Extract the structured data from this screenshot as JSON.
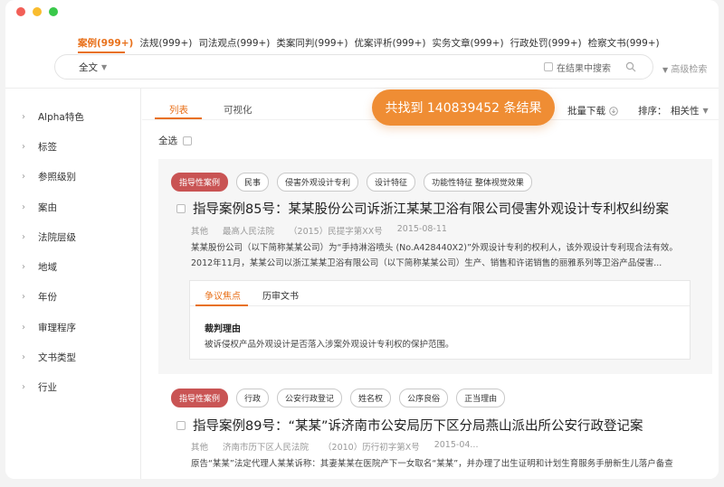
{
  "colors": {
    "accent": "#e8701a",
    "tag_primary": "#c95454",
    "pill": "#ef8d34"
  },
  "top_tabs": [
    {
      "label": "案例(999+)"
    },
    {
      "label": "法规(999+)"
    },
    {
      "label": "司法观点(999+)"
    },
    {
      "label": "类案同判(999+)"
    },
    {
      "label": "优案评析(999+)"
    },
    {
      "label": "实务文章(999+)"
    },
    {
      "label": "行政处罚(999+)"
    },
    {
      "label": "检察文书(999+)"
    }
  ],
  "search": {
    "scope": "全文",
    "value": "",
    "in_result_label": "在结果中搜索",
    "advanced_label": "高级检索"
  },
  "sidebar": {
    "items": [
      {
        "label": "Alpha特色"
      },
      {
        "label": "标签"
      },
      {
        "label": "参照级别"
      },
      {
        "label": "案由"
      },
      {
        "label": "法院层级"
      },
      {
        "label": "地域"
      },
      {
        "label": "年份"
      },
      {
        "label": "审理程序"
      },
      {
        "label": "文书类型"
      },
      {
        "label": "行业"
      }
    ]
  },
  "main": {
    "view_tabs": [
      {
        "label": "列表"
      },
      {
        "label": "可视化"
      }
    ],
    "batch_download": "批量下载",
    "sort_label": "排序：",
    "sort_value": "相关性",
    "select_all": "全选",
    "found_text": "共找到 140839452 条结果"
  },
  "cases": [
    {
      "tags": [
        "指导性案例",
        "民事",
        "侵害外观设计专利",
        "设计特征",
        "功能性特征 整体视觉效果"
      ],
      "title": "指导案例85号：某某股份公司诉浙江某某卫浴有限公司侵害外观设计专利权纠纷案",
      "meta": [
        "其他",
        "最高人民法院",
        "（2015）民提字第XX号",
        "2015-08-11"
      ],
      "summary": [
        "某某股份公司（以下简称某某公司）为“手持淋浴喷头 (No.A428440X2)”外观设计专利的权利人，该外观设计专利现合法有效。",
        "2012年11月，某某公司以浙江某某卫浴有限公司（以下简称某某公司）生产、销售和许诺销售的丽雅系列等卫浴产品侵害..."
      ],
      "detail_tabs": [
        "争议焦点",
        "历审文书"
      ],
      "reason_title": "裁判理由",
      "reason_text": "被诉侵权产品外观设计是否落入涉案外观设计专利权的保护范围。"
    },
    {
      "tags": [
        "指导性案例",
        "行政",
        "公安行政登记",
        "姓名权",
        "公序良俗",
        "正当理由"
      ],
      "title": "指导案例89号：“某某”诉济南市公安局历下区分局燕山派出所公安行政登记案",
      "meta": [
        "其他",
        "济南市历下区人民法院",
        "（2010）历行初字第X号",
        "2015-04..."
      ],
      "summary": [
        "原告“某某”法定代理人某某诉称：其妻某某在医院产下一女取名“某某”，并办理了出生证明和计划生育服务手册新生儿落户备查"
      ]
    }
  ]
}
